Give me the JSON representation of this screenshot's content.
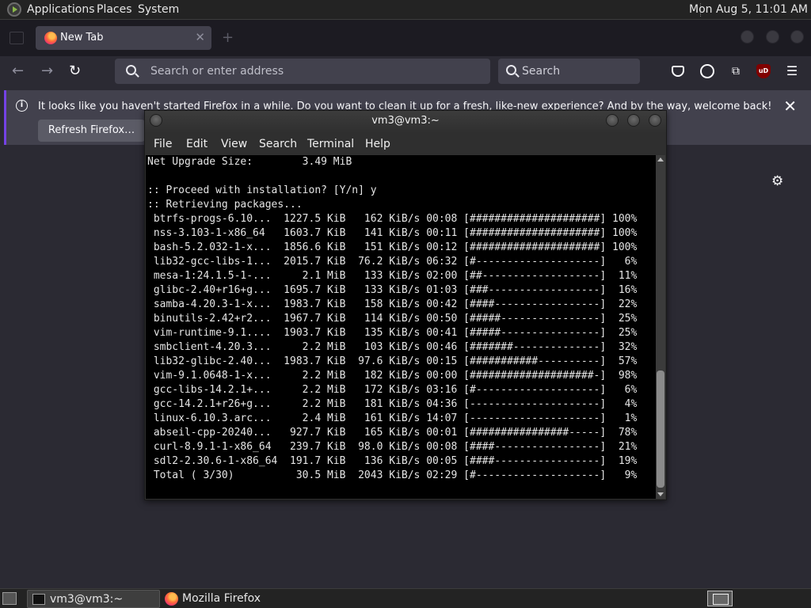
{
  "top_panel": {
    "menus": [
      "Applications",
      "Places",
      "System"
    ],
    "clock": "Mon Aug  5, 11:01 AM"
  },
  "firefox": {
    "tab_title": "New Tab",
    "address_placeholder": "Search or enter address",
    "search_placeholder": "Search",
    "ublock_label": "uD",
    "notice_message": "It looks like you haven't started Firefox in a while. Do you want to clean it up for a fresh, like-new experience? And by the way, welcome back!",
    "refresh_button": "Refresh Firefox…"
  },
  "terminal": {
    "title": "vm3@vm3:~",
    "menu": [
      "File",
      "Edit",
      "View",
      "Search",
      "Terminal",
      "Help"
    ],
    "lines": [
      "Net Upgrade Size:        3.49 MiB",
      "",
      ":: Proceed with installation? [Y/n] y",
      ":: Retrieving packages...",
      " btrfs-progs-6.10...  1227.5 KiB   162 KiB/s 00:08 [#####################] 100%",
      " nss-3.103-1-x86_64   1603.7 KiB   141 KiB/s 00:11 [#####################] 100%",
      " bash-5.2.032-1-x...  1856.6 KiB   151 KiB/s 00:12 [#####################] 100%",
      " lib32-gcc-libs-1...  2015.7 KiB  76.2 KiB/s 06:32 [#--------------------]   6%",
      " mesa-1:24.1.5-1-...     2.1 MiB   133 KiB/s 02:00 [##-------------------]  11%",
      " glibc-2.40+r16+g...  1695.7 KiB   133 KiB/s 01:03 [###------------------]  16%",
      " samba-4.20.3-1-x...  1983.7 KiB   158 KiB/s 00:42 [####-----------------]  22%",
      " binutils-2.42+r2...  1967.7 KiB   114 KiB/s 00:50 [#####----------------]  25%",
      " vim-runtime-9.1....  1903.7 KiB   135 KiB/s 00:41 [#####----------------]  25%",
      " smbclient-4.20.3...     2.2 MiB   103 KiB/s 00:46 [#######--------------]  32%",
      " lib32-glibc-2.40...  1983.7 KiB  97.6 KiB/s 00:15 [###########----------]  57%",
      " vim-9.1.0648-1-x...     2.2 MiB   182 KiB/s 00:00 [####################-]  98%",
      " gcc-libs-14.2.1+...     2.2 MiB   172 KiB/s 03:16 [#--------------------]   6%",
      " gcc-14.2.1+r26+g...     2.2 MiB   181 KiB/s 04:36 [---------------------]   4%",
      " linux-6.10.3.arc...     2.4 MiB   161 KiB/s 14:07 [---------------------]   1%",
      " abseil-cpp-20240...   927.7 KiB   165 KiB/s 00:01 [################-----]  78%",
      " curl-8.9.1-1-x86_64   239.7 KiB  98.0 KiB/s 00:08 [####-----------------]  21%",
      " sdl2-2.30.6-1-x86_64  191.7 KiB   136 KiB/s 00:05 [####-----------------]  19%",
      " Total ( 3/30)          30.5 MiB  2043 KiB/s 02:29 [#--------------------]   9%"
    ]
  },
  "bottom_panel": {
    "tasks": [
      "vm3@vm3:~",
      "Mozilla Firefox"
    ]
  }
}
